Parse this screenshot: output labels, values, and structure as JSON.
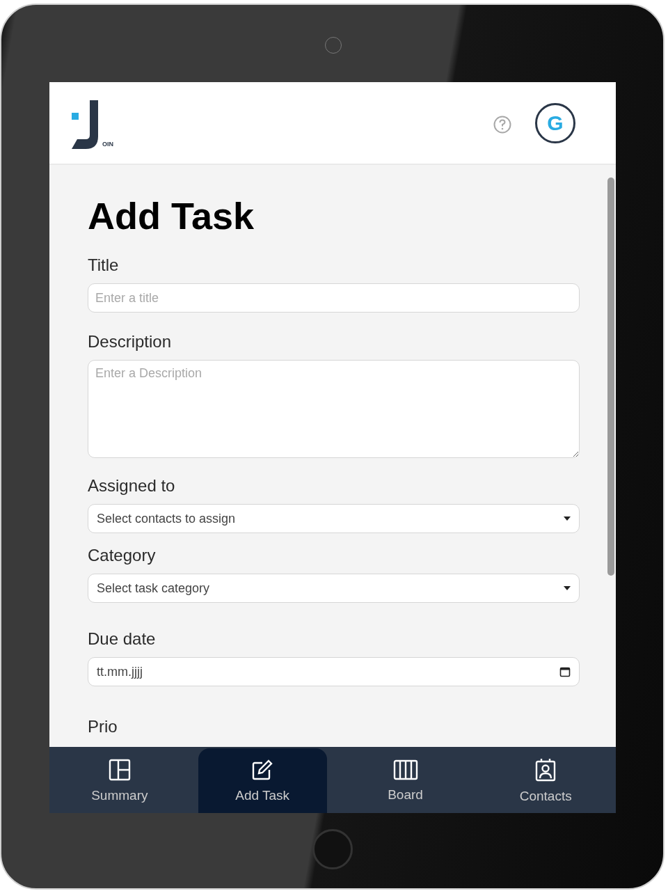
{
  "header": {
    "logo_text": "OIN",
    "avatar": "G"
  },
  "page_title": "Add Task",
  "fields": [
    {
      "kind": "input",
      "label": "Title",
      "placeholder": "Enter a title"
    },
    {
      "kind": "textarea",
      "label": "Description",
      "placeholder": "Enter a Description"
    },
    {
      "kind": "select",
      "label": "Assigned to",
      "value": "Select contacts to assign"
    },
    {
      "kind": "select",
      "label": "Category",
      "value": "Select task category"
    },
    {
      "kind": "date",
      "label": "Due date",
      "value": "tt.mm.jjjj"
    }
  ],
  "next_label": "Prio",
  "nav": [
    {
      "label": "Summary",
      "kind": "summary",
      "selected": false
    },
    {
      "label": "Add Task",
      "kind": "edit",
      "selected": true
    },
    {
      "label": "Board",
      "kind": "board",
      "selected": false
    },
    {
      "label": "Contacts",
      "kind": "contacts",
      "selected": false
    }
  ]
}
